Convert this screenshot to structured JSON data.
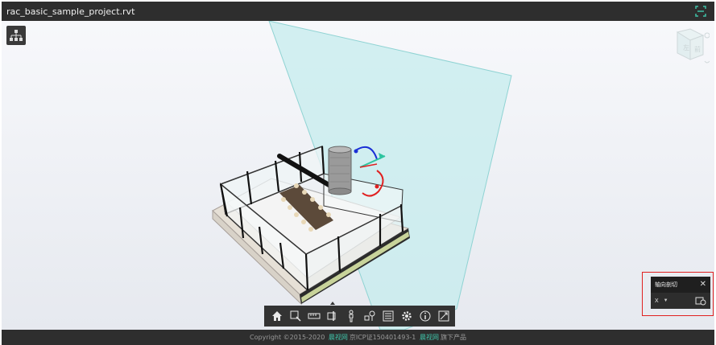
{
  "window": {
    "title": "rac_basic_sample_project.rvt"
  },
  "viewcube": {
    "face_left": "左",
    "face_front": "前"
  },
  "toolbar": {
    "buttons": [
      {
        "name": "home-icon"
      },
      {
        "name": "zoom-window-icon"
      },
      {
        "name": "measure-icon"
      },
      {
        "name": "section-icon",
        "active": true
      },
      {
        "name": "walk-person-icon"
      },
      {
        "name": "explode-icon"
      },
      {
        "name": "properties-icon"
      },
      {
        "name": "settings-gear-icon"
      },
      {
        "name": "info-icon"
      },
      {
        "name": "fullscreen-icon"
      }
    ]
  },
  "section_panel": {
    "title": "轴向剖切",
    "axis": "X",
    "close": "✕"
  },
  "footer": {
    "copyright": "Copyright ©2015-2020",
    "brand1": "晨视网",
    "icp": "京ICP证150401493-1",
    "brand2": "晨视网",
    "suffix": "旗下产品"
  },
  "colors": {
    "accent": "#3fc0a6",
    "highlight": "#e02020",
    "section_plane": "#bfe9ea"
  }
}
